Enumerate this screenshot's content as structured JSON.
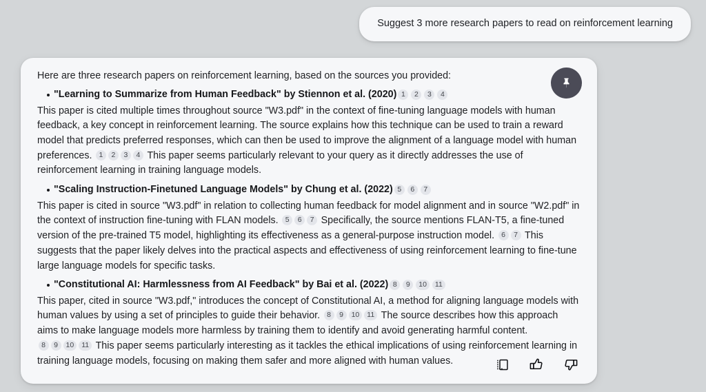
{
  "prompt": {
    "text": "Suggest 3 more research papers to read on reinforcement learning"
  },
  "response": {
    "intro": "Here are three research papers on reinforcement learning, based on the sources you provided:",
    "pin_icon": "pushpin-icon",
    "papers": [
      {
        "title": "\"Learning to Summarize from Human Feedback\" by Stiennon et al. (2020)",
        "title_citations": [
          "1",
          "2",
          "3",
          "4"
        ],
        "body_part1": "This paper is cited multiple times throughout source \"W3.pdf\" in the context of fine-tuning language models with human feedback, a key concept in reinforcement learning. The source explains how this technique can be used to train a reward model that predicts preferred responses, which can then be used to improve the alignment of a language model with human preferences.",
        "body_citations1": [
          "1",
          "2",
          "3",
          "4"
        ],
        "body_part2": "This paper seems particularly relevant to your query as it directly addresses the use of reinforcement learning in training language models.",
        "body_citations2": [],
        "body_part3": ""
      },
      {
        "title": "\"Scaling Instruction-Finetuned Language Models\" by Chung et al. (2022)",
        "title_citations": [
          "5",
          "6",
          "7"
        ],
        "body_part1": "This paper is cited in source \"W3.pdf\" in relation to collecting human feedback for model alignment and in source \"W2.pdf\" in the context of instruction fine-tuning with FLAN models.",
        "body_citations1": [
          "5",
          "6",
          "7"
        ],
        "body_part2": "Specifically, the source mentions FLAN-T5, a fine-tuned version of the pre-trained T5 model, highlighting its effectiveness as a general-purpose instruction model.",
        "body_citations2": [
          "6",
          "7"
        ],
        "body_part3": "This suggests that the paper likely delves into the practical aspects and effectiveness of using reinforcement learning to fine-tune large language models for specific tasks."
      },
      {
        "title": "\"Constitutional AI: Harmlessness from AI Feedback\" by Bai et al. (2022)",
        "title_citations": [
          "8",
          "9",
          "10",
          "11"
        ],
        "body_part1": "This paper, cited in source \"W3.pdf,\" introduces the concept of Constitutional AI, a method for aligning language models with human values by using a set of principles to guide their behavior.",
        "body_citations1": [
          "8",
          "9",
          "10",
          "11"
        ],
        "body_part2": "The source describes how this approach aims to make language models more harmless by training them to identify and avoid generating harmful content.",
        "body_citations2": [
          "8",
          "9",
          "10",
          "11"
        ],
        "body_part3": "This paper seems particularly interesting as it tackles the ethical implications of using reinforcement learning in training language models, focusing on making them safer and more aligned with human values."
      }
    ],
    "actions": [
      {
        "name": "copy-icon",
        "label": "Copy"
      },
      {
        "name": "thumbs-up-icon",
        "label": "Good response"
      },
      {
        "name": "thumbs-down-icon",
        "label": "Bad response"
      }
    ]
  },
  "colors": {
    "page_background": "#d3d6d8",
    "card_background": "#f6f7f9",
    "pin_button": "#4b4b57",
    "chip_background": "#e3e5ea",
    "text": "#202124"
  }
}
